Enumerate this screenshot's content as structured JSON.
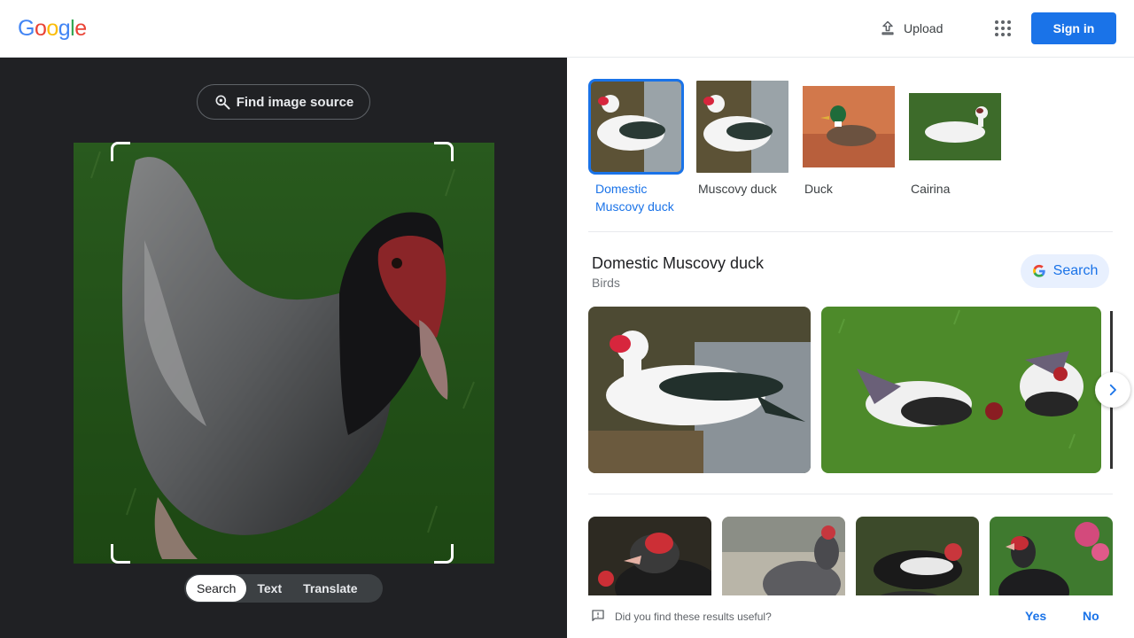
{
  "colors": {
    "brand_blue": "#1a73e8",
    "left_panel_bg": "#202124",
    "logo_blue": "#4285f4",
    "logo_red": "#ea4335",
    "logo_yellow": "#fbbc05",
    "logo_green": "#34a853"
  },
  "header": {
    "logo_letters": [
      "G",
      "o",
      "o",
      "g",
      "l",
      "e"
    ],
    "upload_label": "Upload",
    "upload_icon": "upload-icon",
    "apps_icon": "apps-grid-icon",
    "signin_label": "Sign in"
  },
  "left": {
    "find_source_label": "Find image source",
    "find_source_icon": "lens-search-icon",
    "query_image": "muscovy duck with red caruncles on grass",
    "modes": [
      {
        "label": "Search",
        "active": true
      },
      {
        "label": "Text",
        "active": false
      },
      {
        "label": "Translate",
        "active": false
      }
    ]
  },
  "right": {
    "chips": [
      {
        "label": "Domestic Muscovy duck",
        "active": true,
        "image": "white muscovy duck on fence"
      },
      {
        "label": "Muscovy duck",
        "active": false,
        "image": "white muscovy duck on fence"
      },
      {
        "label": "Duck",
        "active": false,
        "image": "mallard on water"
      },
      {
        "label": "Cairina",
        "active": false,
        "image": "white duck on grass"
      }
    ],
    "entity": {
      "title": "Domestic Muscovy duck",
      "subtitle": "Birds",
      "search_label": "Search",
      "search_icon": "google-g-icon"
    },
    "next_icon": "chevron-right-icon",
    "feedback": {
      "question": "Did you find these results useful?",
      "icon": "feedback-icon",
      "yes": "Yes",
      "no": "No"
    }
  }
}
